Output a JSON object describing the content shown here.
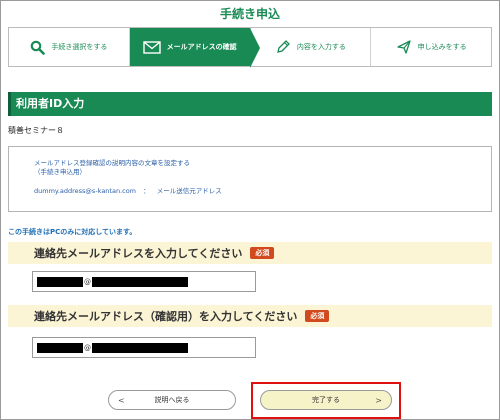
{
  "page": {
    "title": "手続き申込"
  },
  "steps": [
    {
      "label": "手続き選択をする",
      "icon": "search-icon",
      "active": false
    },
    {
      "label": "メールアドレスの確認",
      "icon": "envelope-icon",
      "active": true
    },
    {
      "label": "内容を入力する",
      "icon": "pencil-icon",
      "active": false
    },
    {
      "label": "申し込みをする",
      "icon": "send-icon",
      "active": false
    }
  ],
  "section": {
    "title": "利用者ID入力"
  },
  "seminar": {
    "name": "積善セミナー８"
  },
  "notice": {
    "line1": "メールアドレス登録確認の説明内容の文章を設定する",
    "line2": "（手続き申込用）",
    "address": "dummy.address@s-kantan.com",
    "separator": "：",
    "address_label": "メール送信元アドレス"
  },
  "pc_note": "この手続きはPCのみに対応しています。",
  "email_field": {
    "label": "連絡先メールアドレスを入力してください",
    "required": "必須",
    "at": "@"
  },
  "confirm_field": {
    "label": "連絡先メールアドレス（確認用）を入力してください",
    "required": "必須",
    "at": "@"
  },
  "buttons": {
    "back": "説明へ戻る",
    "back_arrow": "<",
    "complete": "完了する",
    "complete_arrow": ">"
  },
  "colors": {
    "brand_green": "#1a8a55",
    "required_red": "#d14a1e",
    "highlight": "#e01010",
    "field_bg": "#fbf5d6"
  }
}
